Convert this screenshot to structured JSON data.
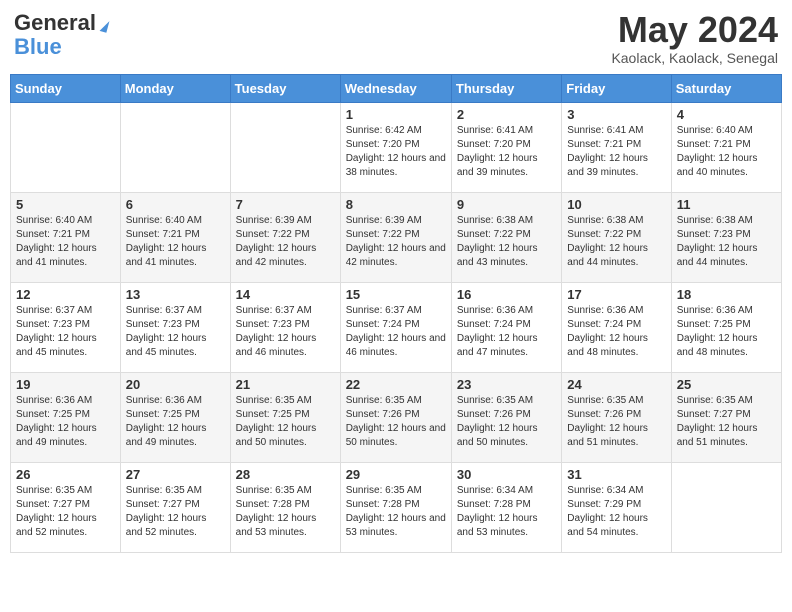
{
  "header": {
    "logo_general": "General",
    "logo_blue": "Blue",
    "title": "May 2024",
    "location": "Kaolack, Kaolack, Senegal"
  },
  "weekdays": [
    "Sunday",
    "Monday",
    "Tuesday",
    "Wednesday",
    "Thursday",
    "Friday",
    "Saturday"
  ],
  "weeks": [
    [
      {
        "day": "",
        "sunrise": "",
        "sunset": "",
        "daylight": ""
      },
      {
        "day": "",
        "sunrise": "",
        "sunset": "",
        "daylight": ""
      },
      {
        "day": "",
        "sunrise": "",
        "sunset": "",
        "daylight": ""
      },
      {
        "day": "1",
        "sunrise": "Sunrise: 6:42 AM",
        "sunset": "Sunset: 7:20 PM",
        "daylight": "Daylight: 12 hours and 38 minutes."
      },
      {
        "day": "2",
        "sunrise": "Sunrise: 6:41 AM",
        "sunset": "Sunset: 7:20 PM",
        "daylight": "Daylight: 12 hours and 39 minutes."
      },
      {
        "day": "3",
        "sunrise": "Sunrise: 6:41 AM",
        "sunset": "Sunset: 7:21 PM",
        "daylight": "Daylight: 12 hours and 39 minutes."
      },
      {
        "day": "4",
        "sunrise": "Sunrise: 6:40 AM",
        "sunset": "Sunset: 7:21 PM",
        "daylight": "Daylight: 12 hours and 40 minutes."
      }
    ],
    [
      {
        "day": "5",
        "sunrise": "Sunrise: 6:40 AM",
        "sunset": "Sunset: 7:21 PM",
        "daylight": "Daylight: 12 hours and 41 minutes."
      },
      {
        "day": "6",
        "sunrise": "Sunrise: 6:40 AM",
        "sunset": "Sunset: 7:21 PM",
        "daylight": "Daylight: 12 hours and 41 minutes."
      },
      {
        "day": "7",
        "sunrise": "Sunrise: 6:39 AM",
        "sunset": "Sunset: 7:22 PM",
        "daylight": "Daylight: 12 hours and 42 minutes."
      },
      {
        "day": "8",
        "sunrise": "Sunrise: 6:39 AM",
        "sunset": "Sunset: 7:22 PM",
        "daylight": "Daylight: 12 hours and 42 minutes."
      },
      {
        "day": "9",
        "sunrise": "Sunrise: 6:38 AM",
        "sunset": "Sunset: 7:22 PM",
        "daylight": "Daylight: 12 hours and 43 minutes."
      },
      {
        "day": "10",
        "sunrise": "Sunrise: 6:38 AM",
        "sunset": "Sunset: 7:22 PM",
        "daylight": "Daylight: 12 hours and 44 minutes."
      },
      {
        "day": "11",
        "sunrise": "Sunrise: 6:38 AM",
        "sunset": "Sunset: 7:23 PM",
        "daylight": "Daylight: 12 hours and 44 minutes."
      }
    ],
    [
      {
        "day": "12",
        "sunrise": "Sunrise: 6:37 AM",
        "sunset": "Sunset: 7:23 PM",
        "daylight": "Daylight: 12 hours and 45 minutes."
      },
      {
        "day": "13",
        "sunrise": "Sunrise: 6:37 AM",
        "sunset": "Sunset: 7:23 PM",
        "daylight": "Daylight: 12 hours and 45 minutes."
      },
      {
        "day": "14",
        "sunrise": "Sunrise: 6:37 AM",
        "sunset": "Sunset: 7:23 PM",
        "daylight": "Daylight: 12 hours and 46 minutes."
      },
      {
        "day": "15",
        "sunrise": "Sunrise: 6:37 AM",
        "sunset": "Sunset: 7:24 PM",
        "daylight": "Daylight: 12 hours and 46 minutes."
      },
      {
        "day": "16",
        "sunrise": "Sunrise: 6:36 AM",
        "sunset": "Sunset: 7:24 PM",
        "daylight": "Daylight: 12 hours and 47 minutes."
      },
      {
        "day": "17",
        "sunrise": "Sunrise: 6:36 AM",
        "sunset": "Sunset: 7:24 PM",
        "daylight": "Daylight: 12 hours and 48 minutes."
      },
      {
        "day": "18",
        "sunrise": "Sunrise: 6:36 AM",
        "sunset": "Sunset: 7:25 PM",
        "daylight": "Daylight: 12 hours and 48 minutes."
      }
    ],
    [
      {
        "day": "19",
        "sunrise": "Sunrise: 6:36 AM",
        "sunset": "Sunset: 7:25 PM",
        "daylight": "Daylight: 12 hours and 49 minutes."
      },
      {
        "day": "20",
        "sunrise": "Sunrise: 6:36 AM",
        "sunset": "Sunset: 7:25 PM",
        "daylight": "Daylight: 12 hours and 49 minutes."
      },
      {
        "day": "21",
        "sunrise": "Sunrise: 6:35 AM",
        "sunset": "Sunset: 7:25 PM",
        "daylight": "Daylight: 12 hours and 50 minutes."
      },
      {
        "day": "22",
        "sunrise": "Sunrise: 6:35 AM",
        "sunset": "Sunset: 7:26 PM",
        "daylight": "Daylight: 12 hours and 50 minutes."
      },
      {
        "day": "23",
        "sunrise": "Sunrise: 6:35 AM",
        "sunset": "Sunset: 7:26 PM",
        "daylight": "Daylight: 12 hours and 50 minutes."
      },
      {
        "day": "24",
        "sunrise": "Sunrise: 6:35 AM",
        "sunset": "Sunset: 7:26 PM",
        "daylight": "Daylight: 12 hours and 51 minutes."
      },
      {
        "day": "25",
        "sunrise": "Sunrise: 6:35 AM",
        "sunset": "Sunset: 7:27 PM",
        "daylight": "Daylight: 12 hours and 51 minutes."
      }
    ],
    [
      {
        "day": "26",
        "sunrise": "Sunrise: 6:35 AM",
        "sunset": "Sunset: 7:27 PM",
        "daylight": "Daylight: 12 hours and 52 minutes."
      },
      {
        "day": "27",
        "sunrise": "Sunrise: 6:35 AM",
        "sunset": "Sunset: 7:27 PM",
        "daylight": "Daylight: 12 hours and 52 minutes."
      },
      {
        "day": "28",
        "sunrise": "Sunrise: 6:35 AM",
        "sunset": "Sunset: 7:28 PM",
        "daylight": "Daylight: 12 hours and 53 minutes."
      },
      {
        "day": "29",
        "sunrise": "Sunrise: 6:35 AM",
        "sunset": "Sunset: 7:28 PM",
        "daylight": "Daylight: 12 hours and 53 minutes."
      },
      {
        "day": "30",
        "sunrise": "Sunrise: 6:34 AM",
        "sunset": "Sunset: 7:28 PM",
        "daylight": "Daylight: 12 hours and 53 minutes."
      },
      {
        "day": "31",
        "sunrise": "Sunrise: 6:34 AM",
        "sunset": "Sunset: 7:29 PM",
        "daylight": "Daylight: 12 hours and 54 minutes."
      },
      {
        "day": "",
        "sunrise": "",
        "sunset": "",
        "daylight": ""
      }
    ]
  ]
}
